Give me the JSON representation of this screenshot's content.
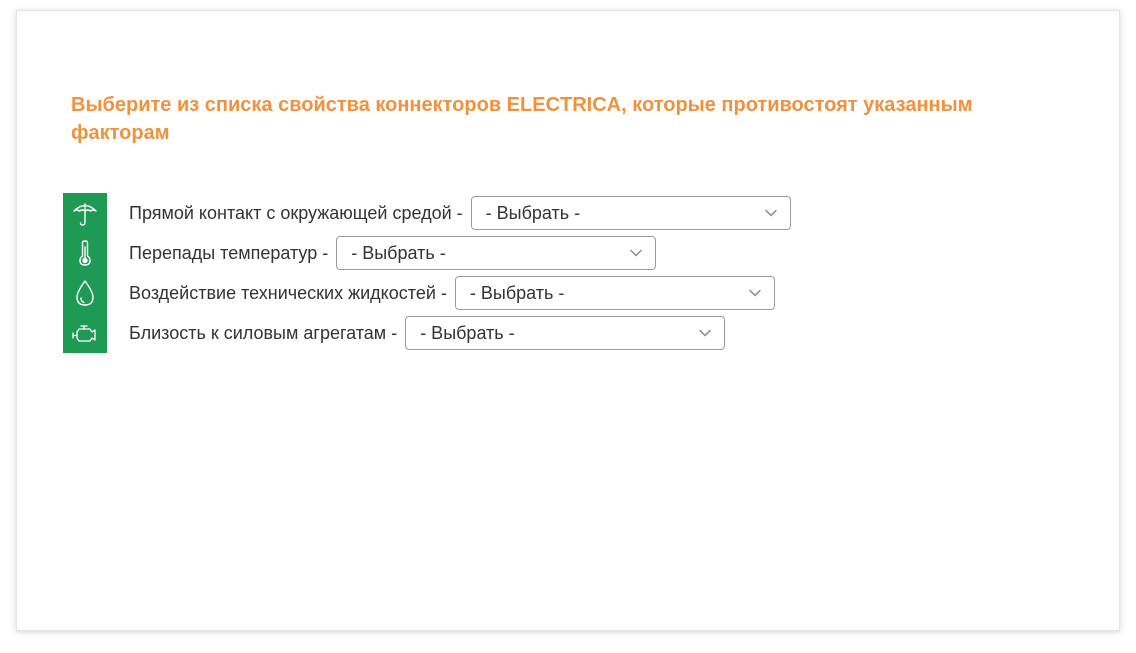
{
  "heading": "Выберите из списка свойства коннекторов ELECTRICA, которые противостоят указанным факторам",
  "colors": {
    "heading": "#f0913e",
    "icon_bg": "#1f9a55"
  },
  "rows": [
    {
      "icon": "umbrella-icon",
      "label": "Прямой контакт с окружающей средой -",
      "select_value": "- Выбрать -"
    },
    {
      "icon": "thermometer-icon",
      "label": "Перепады температур -",
      "select_value": "- Выбрать -"
    },
    {
      "icon": "drop-icon",
      "label": "Воздействие технических жидкостей -",
      "select_value": "- Выбрать -"
    },
    {
      "icon": "engine-icon",
      "label": "Близость к силовым агрегатам -",
      "select_value": "- Выбрать -"
    }
  ]
}
